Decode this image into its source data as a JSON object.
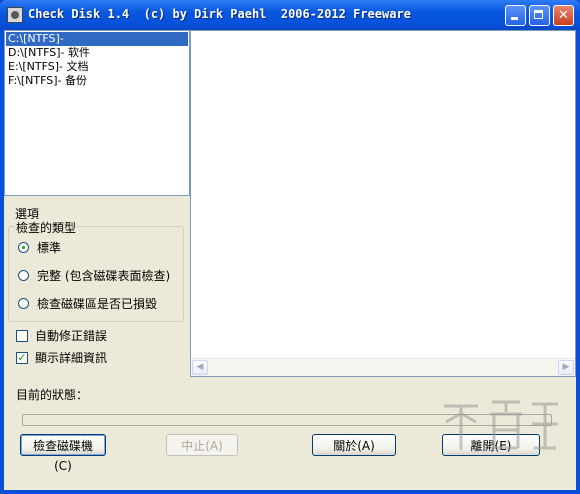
{
  "window": {
    "title": "Check Disk 1.4  (c) by Dirk Paehl  2006-2012 Freeware"
  },
  "drives": [
    {
      "label": "C:\\[NTFS]-",
      "selected": true
    },
    {
      "label": "D:\\[NTFS]- 软件",
      "selected": false
    },
    {
      "label": "E:\\[NTFS]- 文档",
      "selected": false
    },
    {
      "label": "F:\\[NTFS]- 备份",
      "selected": false
    }
  ],
  "options": {
    "title": "選項",
    "group_label": "檢查的類型",
    "radios": [
      {
        "label": "標準",
        "checked": true
      },
      {
        "label": "完整 (包含磁碟表面檢查)",
        "checked": false
      },
      {
        "label": "檢查磁碟區是否已損毀",
        "checked": false
      }
    ],
    "checkboxes": [
      {
        "label": "自動修正錯誤",
        "checked": false
      },
      {
        "label": "顯示詳細資訊",
        "checked": true
      }
    ]
  },
  "status": {
    "label": "目前的狀態：",
    "progress": 0
  },
  "buttons": {
    "check": "檢查磁碟機(C)",
    "abort": "中止(A)",
    "about": "關於(A)",
    "exit": "離開(E)"
  },
  "colors": {
    "titlebar": "#0858e0",
    "selection": "#316ac5",
    "face": "#ece9d8"
  }
}
